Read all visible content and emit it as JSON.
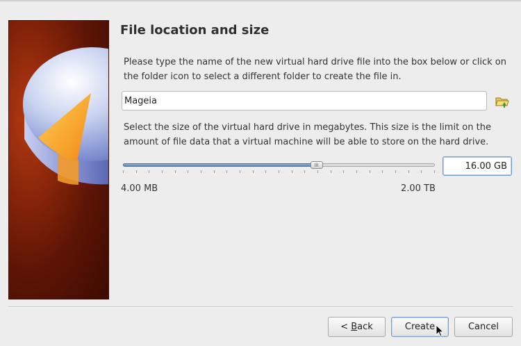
{
  "wizard": {
    "title": "File location and size"
  },
  "location": {
    "description": "Please type the name of the new virtual hard drive file into the box below or click on the folder icon to select a different folder to create the file in.",
    "file_name": "Mageia",
    "folder_icon": "folder-open-icon"
  },
  "size": {
    "description": "Select the size of the virtual hard drive in megabytes. This size is the limit on the amount of file data that a virtual machine will be able to store on the hard drive.",
    "value_text": "16.00 GB",
    "slider_fraction": 0.627,
    "min_label": "4.00 MB",
    "max_label": "2.00 TB"
  },
  "buttons": {
    "back_prefix": "< ",
    "back_mnemonic": "B",
    "back_rest": "ack",
    "create": "Create",
    "cancel": "Cancel"
  },
  "colors": {
    "slider_fill": "#5d87b5",
    "focus_border": "#6f9bd0",
    "side_panel": "#8a260a"
  }
}
